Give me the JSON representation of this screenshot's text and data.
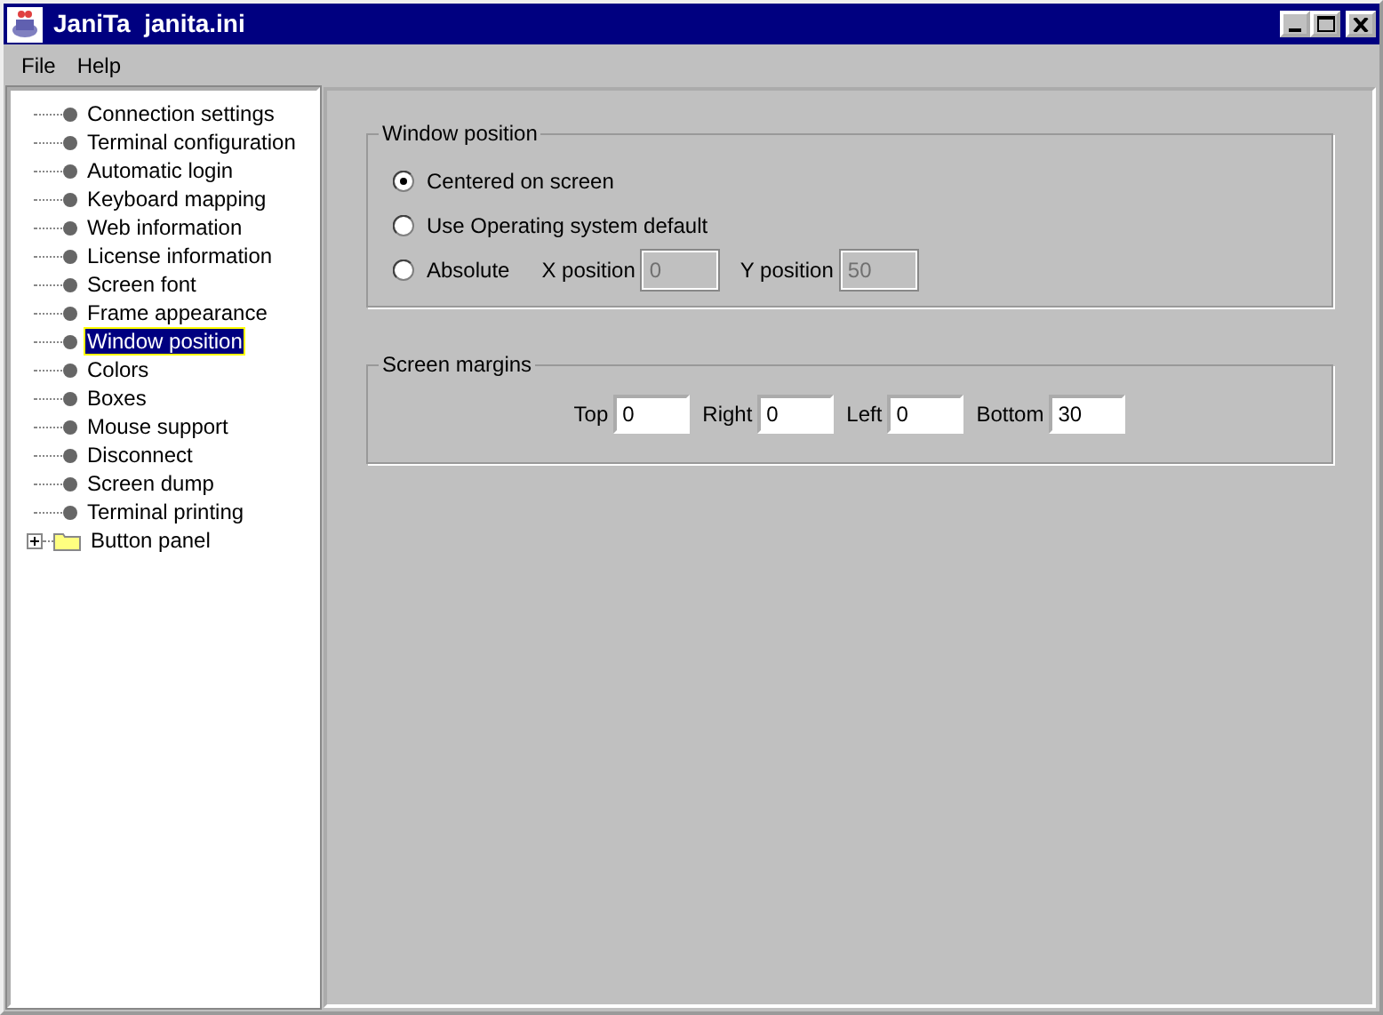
{
  "window": {
    "title": "JaniTa  janita.ini"
  },
  "menu": [
    "File",
    "Help"
  ],
  "tree": [
    {
      "kind": "leaf",
      "label": "Connection settings",
      "selected": false
    },
    {
      "kind": "leaf",
      "label": "Terminal configuration",
      "selected": false
    },
    {
      "kind": "leaf",
      "label": "Automatic login",
      "selected": false
    },
    {
      "kind": "leaf",
      "label": "Keyboard mapping",
      "selected": false
    },
    {
      "kind": "leaf",
      "label": "Web information",
      "selected": false
    },
    {
      "kind": "leaf",
      "label": "License information",
      "selected": false
    },
    {
      "kind": "leaf",
      "label": "Screen font",
      "selected": false
    },
    {
      "kind": "leaf",
      "label": "Frame appearance",
      "selected": false
    },
    {
      "kind": "leaf",
      "label": "Window position",
      "selected": true
    },
    {
      "kind": "leaf",
      "label": "Colors",
      "selected": false
    },
    {
      "kind": "leaf",
      "label": "Boxes",
      "selected": false
    },
    {
      "kind": "leaf",
      "label": "Mouse support",
      "selected": false
    },
    {
      "kind": "leaf",
      "label": "Disconnect",
      "selected": false
    },
    {
      "kind": "leaf",
      "label": "Screen dump",
      "selected": false
    },
    {
      "kind": "leaf",
      "label": "Terminal printing",
      "selected": false
    },
    {
      "kind": "folder",
      "label": "Button panel",
      "selected": false,
      "expanded": false
    }
  ],
  "window_position": {
    "title": "Window position",
    "options": [
      {
        "label": "Centered on screen",
        "selected": true
      },
      {
        "label": "Use Operating system default",
        "selected": false
      },
      {
        "label": "Absolute",
        "selected": false
      }
    ],
    "fields": [
      {
        "label": "X position",
        "value": "0",
        "disabled": true
      },
      {
        "label": "Y position",
        "value": "50",
        "disabled": true
      }
    ]
  },
  "screen_margins": {
    "title": "Screen margins",
    "fields": [
      {
        "label": "Top",
        "value": "0"
      },
      {
        "label": "Right",
        "value": "0"
      },
      {
        "label": "Left",
        "value": "0"
      },
      {
        "label": "Bottom",
        "value": "30"
      }
    ]
  }
}
